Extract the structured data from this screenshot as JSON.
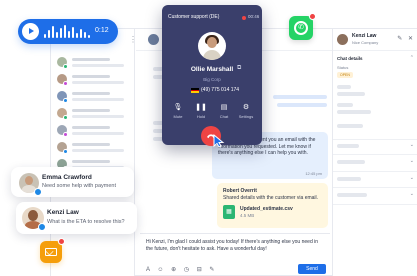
{
  "voice_message": {
    "duration": "0:12"
  },
  "phone_widget": {
    "title": "Customer support (DE)",
    "timer": "00:46",
    "caller_name": "Ollie Marshall",
    "caller_company": "Big Corp",
    "caller_number": "(49) 775 014 174",
    "buttons": [
      {
        "label": "Mute",
        "icon": "mic-off-icon"
      },
      {
        "label": "Hold",
        "icon": "pause-icon"
      },
      {
        "label": "Chat",
        "icon": "chat-icon"
      },
      {
        "label": "Settings",
        "icon": "gear-icon"
      }
    ]
  },
  "contact_panel": {
    "name": "Kenzi Law",
    "company": "Nice Company",
    "section_title": "Chat details",
    "status_label": "Status",
    "status_value": "OPEN"
  },
  "messages": {
    "incoming": "Hi Kenzi, I've just sent you an email with the information you requested. Let me know if there's anything else I can help you with.",
    "incoming_time": "12:45 pm",
    "note_author": "Robert Overrit",
    "note_text": "Shared details with the customer via email.",
    "file_name": "Updated_estimate.csv",
    "file_size": "4.5 MB",
    "composer_text": "Hi Kenzi, I'm glad I could assist you today! If there's anything else you need in the future, don't hesitate to ask. Have a wonderful day!",
    "send_label": "Send"
  },
  "cards": [
    {
      "name": "Emma Crawford",
      "message": "Need some help with payment"
    },
    {
      "name": "Kenzi Law",
      "message": "What is the ETA to resolve this?"
    }
  ],
  "colors": {
    "accent": "#1e6ee8",
    "phone_bg": "#3a3f6b",
    "hangup": "#ef4444",
    "whatsapp": "#25d366",
    "mail": "#f59e0b",
    "incoming_bubble": "#e5effd",
    "note_bubble": "#fff7e0"
  }
}
